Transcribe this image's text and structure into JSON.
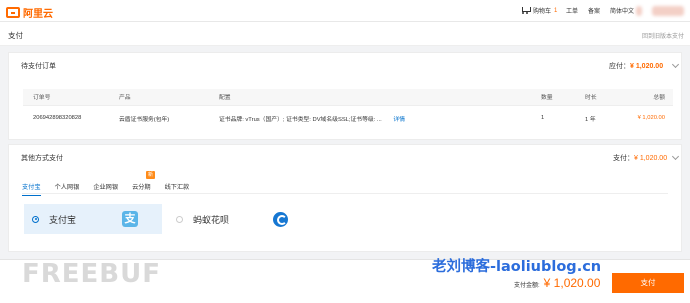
{
  "brand": {
    "name": "阿里云"
  },
  "topnav": {
    "cart": "购物车",
    "cart_count": "1",
    "ticket": "工单",
    "record": "备案",
    "enterprise": "简体中文"
  },
  "header": {
    "title": "支付",
    "back_link": "回到旧版本支付"
  },
  "pending": {
    "title": "待支付订单",
    "payable_label": "应付：",
    "payable_value": "¥ 1,020.00",
    "columns": [
      "订单号",
      "产品",
      "配置",
      "数量",
      "时长",
      "总额"
    ],
    "row": {
      "order_no": "206942898320828",
      "product": "云盾证书服务(包年)",
      "config": "证书品牌: vTrus（国产）; 证书类型: DV域名级SSL;证书等级: ...",
      "detail": "详情",
      "quantity": "1",
      "duration": "1 年",
      "total": "¥ 1,020.00"
    }
  },
  "other": {
    "title": "其他方式支付",
    "pay_label": "支付：",
    "pay_value": "¥ 1,020.00",
    "tabs": [
      "支付宝",
      "个人网银",
      "企业网银",
      "云分期",
      "线下汇款"
    ],
    "hot_badge": "新",
    "options": [
      {
        "label": "支付宝",
        "icon": "支"
      },
      {
        "label": "蚂蚁花呗"
      }
    ]
  },
  "footer": {
    "watermark_left": "FREEBUF",
    "watermark_right": "老刘博客-laoliublog.cn",
    "total_label": "支付金额:",
    "total_value": "¥ 1,020.00",
    "pay_button": "支付"
  },
  "colors": {
    "accent": "#ff6a00",
    "link": "#0070cc"
  }
}
